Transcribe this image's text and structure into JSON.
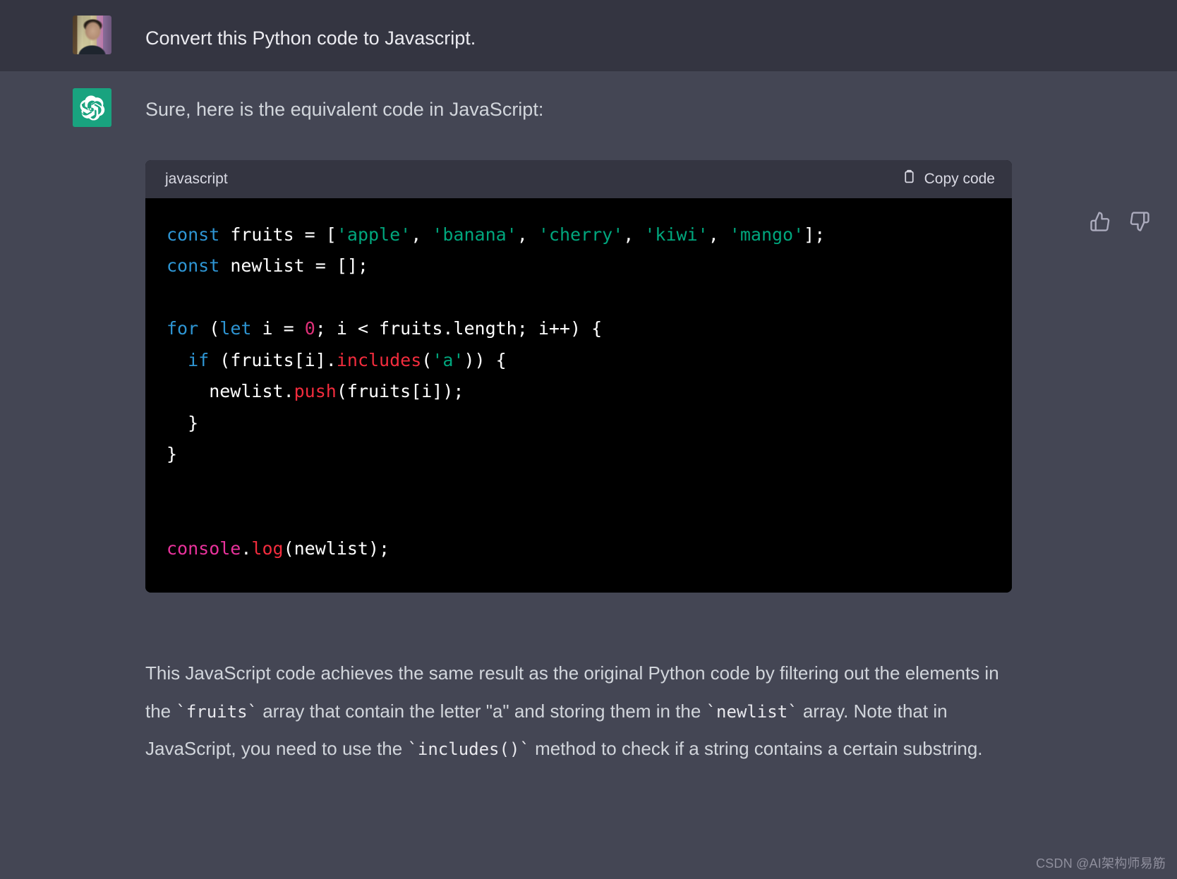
{
  "user_message": {
    "avatar_name": "user-photo-avatar",
    "text": "Convert this Python code to Javascript."
  },
  "assistant_message": {
    "avatar_name": "openai-logo-avatar",
    "intro_text": "Sure, here is the equivalent code in JavaScript:",
    "closing_paragraph": {
      "part1": "This JavaScript code achieves the same result as the original Python code by filtering out the elements in the ",
      "code1": "`fruits`",
      "part2": " array that contain the letter \"a\" and storing them in the ",
      "code2": "`newlist`",
      "part3": " array. Note that in JavaScript, you need to use the ",
      "code3": "`includes()`",
      "part4": " method to check if a string contains a certain substring."
    }
  },
  "feedback": {
    "thumbs_up_label": "thumbs-up",
    "thumbs_down_label": "thumbs-down"
  },
  "code_block": {
    "language": "javascript",
    "copy_label": "Copy code",
    "copy_icon": "clipboard-icon",
    "colors": {
      "keyword": "#2e95d3",
      "string": "#00a67d",
      "number": "#df3079",
      "function_red": "#f22c3d",
      "object_pink": "#e9329c",
      "method_orange": "#f22c3d",
      "plain": "#ffffff",
      "background": "#000000"
    },
    "lines": [
      [
        {
          "t": "const",
          "c": "keyword"
        },
        {
          "t": " fruits = [",
          "c": "plain"
        },
        {
          "t": "'apple'",
          "c": "string"
        },
        {
          "t": ", ",
          "c": "plain"
        },
        {
          "t": "'banana'",
          "c": "string"
        },
        {
          "t": ", ",
          "c": "plain"
        },
        {
          "t": "'cherry'",
          "c": "string"
        },
        {
          "t": ", ",
          "c": "plain"
        },
        {
          "t": "'kiwi'",
          "c": "string"
        },
        {
          "t": ", ",
          "c": "plain"
        },
        {
          "t": "'mango'",
          "c": "string"
        },
        {
          "t": "];",
          "c": "plain"
        }
      ],
      [
        {
          "t": "const",
          "c": "keyword"
        },
        {
          "t": " newlist = [];",
          "c": "plain"
        }
      ],
      [],
      [
        {
          "t": "for",
          "c": "keyword"
        },
        {
          "t": " (",
          "c": "plain"
        },
        {
          "t": "let",
          "c": "keyword"
        },
        {
          "t": " i = ",
          "c": "plain"
        },
        {
          "t": "0",
          "c": "number"
        },
        {
          "t": "; i < fruits.length; i++) {",
          "c": "plain"
        }
      ],
      [
        {
          "t": "  ",
          "c": "plain"
        },
        {
          "t": "if",
          "c": "keyword"
        },
        {
          "t": " (fruits[i].",
          "c": "plain"
        },
        {
          "t": "includes",
          "c": "function_red"
        },
        {
          "t": "(",
          "c": "plain"
        },
        {
          "t": "'a'",
          "c": "string"
        },
        {
          "t": ")) {",
          "c": "plain"
        }
      ],
      [
        {
          "t": "    newlist.",
          "c": "plain"
        },
        {
          "t": "push",
          "c": "function_red"
        },
        {
          "t": "(fruits[i]);",
          "c": "plain"
        }
      ],
      [
        {
          "t": "  }",
          "c": "plain"
        }
      ],
      [
        {
          "t": "}",
          "c": "plain"
        }
      ],
      [],
      [],
      [
        {
          "t": "console",
          "c": "object_pink"
        },
        {
          "t": ".",
          "c": "plain"
        },
        {
          "t": "log",
          "c": "method_orange"
        },
        {
          "t": "(newlist);",
          "c": "plain"
        }
      ]
    ]
  },
  "watermark": {
    "text": "CSDN @AI架构师易筋"
  }
}
